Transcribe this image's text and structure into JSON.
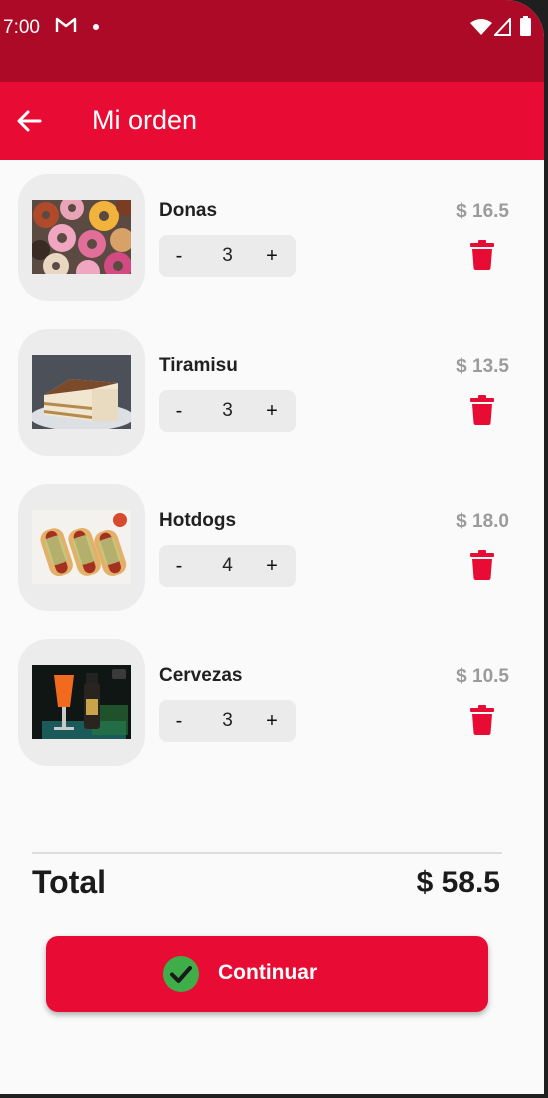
{
  "status_bar": {
    "time": "7:00"
  },
  "app_bar": {
    "title": "Mi orden"
  },
  "items": [
    {
      "name": "Donas",
      "quantity": "3",
      "price": "$ 16.5"
    },
    {
      "name": "Tiramisu",
      "quantity": "3",
      "price": "$ 13.5"
    },
    {
      "name": "Hotdogs",
      "quantity": "4",
      "price": "$ 18.0"
    },
    {
      "name": "Cervezas",
      "quantity": "3",
      "price": "$ 10.5"
    }
  ],
  "stepper": {
    "minus": "-",
    "plus": "+"
  },
  "summary": {
    "total_label": "Total",
    "total_value": "$ 58.5"
  },
  "actions": {
    "continue_label": "Continuar"
  },
  "colors": {
    "status_bar": "#ac0a26",
    "primary": "#e80c34",
    "price_gray": "#9b9b9b",
    "check_green": "#3fae49"
  },
  "icons": {
    "back": "arrow-left-icon",
    "delete": "trash-icon",
    "confirm": "check-circle-icon",
    "gmail": "gmail-icon",
    "wifi": "wifi-icon",
    "signal": "signal-icon",
    "battery": "battery-icon"
  }
}
